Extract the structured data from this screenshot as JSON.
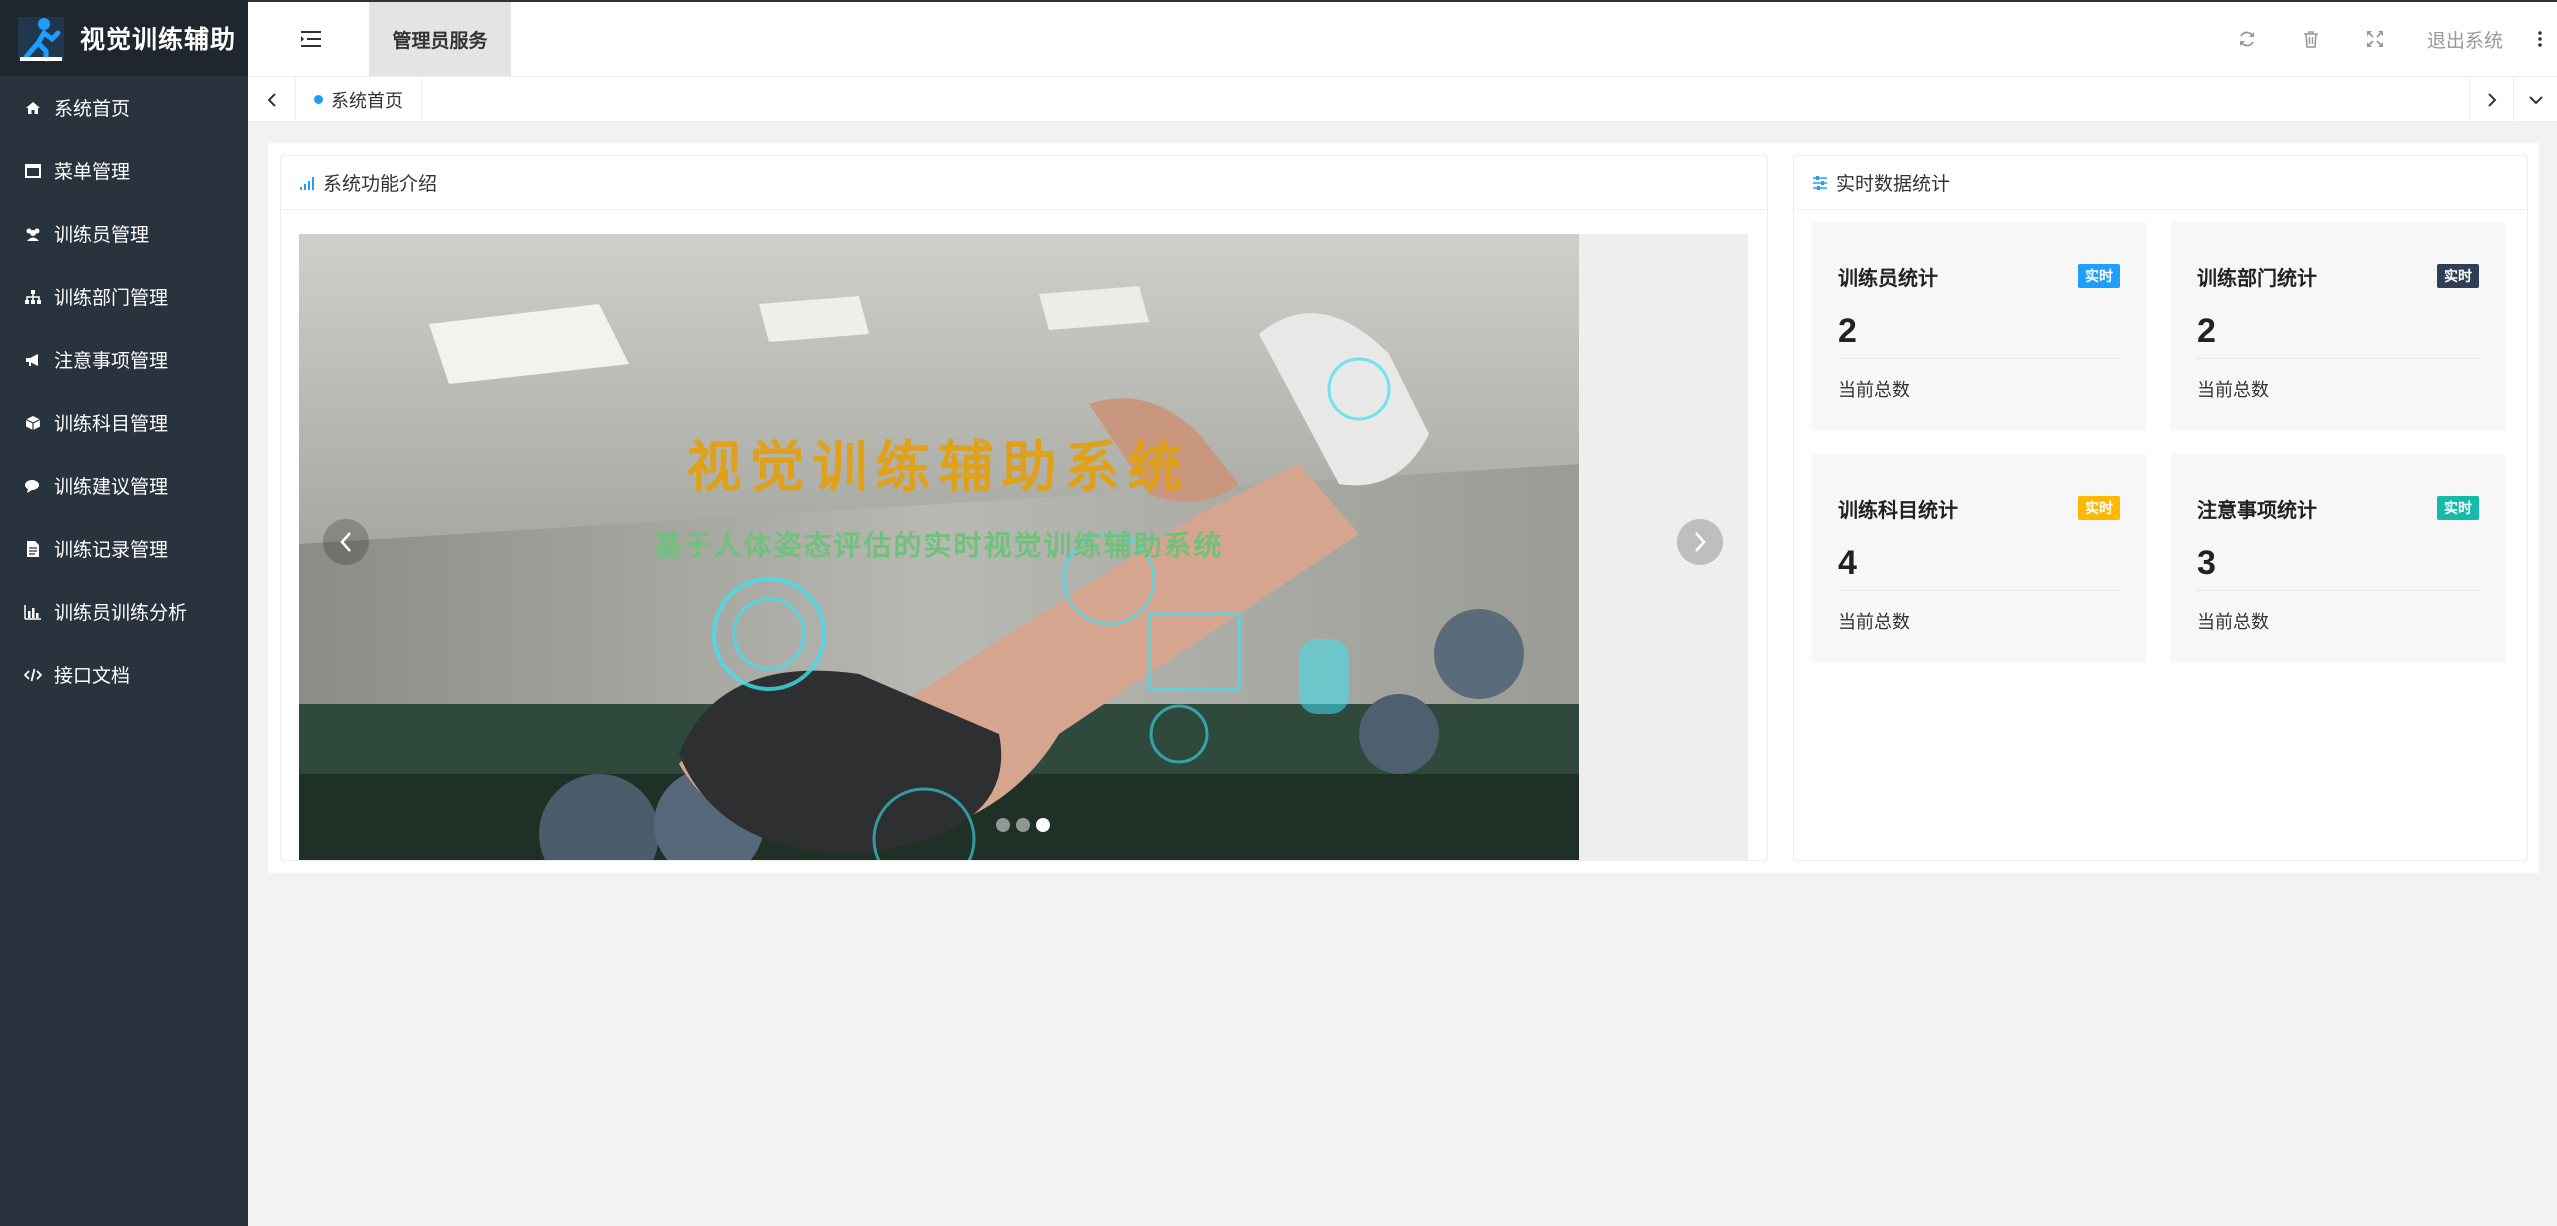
{
  "app": {
    "title": "视觉训练辅助"
  },
  "sidebar": {
    "items": [
      {
        "label": "系统首页",
        "icon": "home-icon"
      },
      {
        "label": "菜单管理",
        "icon": "window-icon"
      },
      {
        "label": "训练员管理",
        "icon": "users-icon"
      },
      {
        "label": "训练部门管理",
        "icon": "sitemap-icon"
      },
      {
        "label": "注意事项管理",
        "icon": "bullhorn-icon"
      },
      {
        "label": "训练科目管理",
        "icon": "cube-icon"
      },
      {
        "label": "训练建议管理",
        "icon": "comments-icon"
      },
      {
        "label": "训练记录管理",
        "icon": "file-icon"
      },
      {
        "label": "训练员训练分析",
        "icon": "bar-chart-icon"
      },
      {
        "label": "接口文档",
        "icon": "code-icon"
      }
    ]
  },
  "header": {
    "tab_label": "管理员服务",
    "logout_label": "退出系统"
  },
  "tabbar": {
    "active_tab": "系统首页",
    "dot_color": "#1e9fff"
  },
  "intro": {
    "title": "系统功能介绍",
    "carousel_title": "视觉训练辅助系统",
    "carousel_subtitle": "基于人体姿态评估的实时视觉训练辅助系统"
  },
  "stats": {
    "title": "实时数据统计",
    "cards": [
      {
        "title": "训练员统计",
        "badge": "实时",
        "badge_color": "#1e9fff",
        "value": "2",
        "label": "当前总数"
      },
      {
        "title": "训练部门统计",
        "badge": "实时",
        "badge_color": "#2f4056",
        "value": "2",
        "label": "当前总数"
      },
      {
        "title": "训练科目统计",
        "badge": "实时",
        "badge_color": "#ffb800",
        "value": "4",
        "label": "当前总数"
      },
      {
        "title": "注意事项统计",
        "badge": "实时",
        "badge_color": "#16baaa",
        "value": "3",
        "label": "当前总数"
      }
    ]
  },
  "colors": {
    "sidebar_bg": "#28333e",
    "logo_bg": "#20262e",
    "accent": "#1e9fff"
  }
}
